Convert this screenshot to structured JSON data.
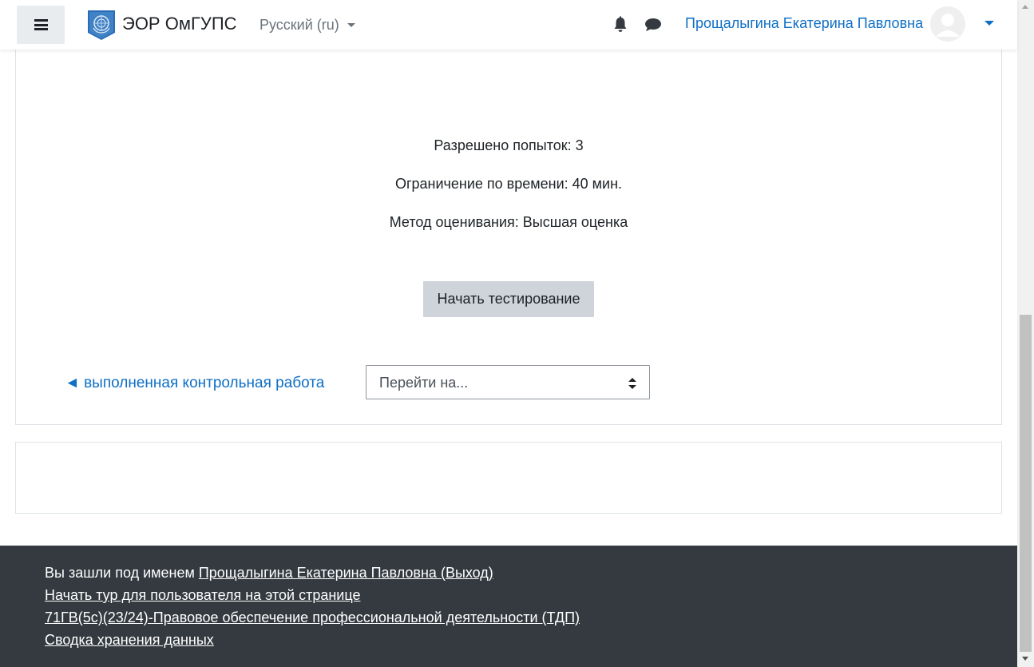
{
  "header": {
    "site_name": "ЭОР ОмГУПС",
    "language": "Русский (ru)",
    "user_name": "Прощалыгина Екатерина Павловна",
    "icons": [
      "menu-icon",
      "bell-icon",
      "chat-icon",
      "avatar-icon",
      "chevron-down-icon"
    ]
  },
  "quiz": {
    "attempts_allowed": "Разрешено попыток: 3",
    "time_limit": "Ограничение по времени: 40 мин.",
    "grading_method": "Метод оценивания: Высшая оценка",
    "start_button": "Начать тестирование"
  },
  "navigation": {
    "prev_activity": "◄ выполненная контрольная работа",
    "jump_to_placeholder": "Перейти на..."
  },
  "footer": {
    "logged_in_prefix": "Вы зашли под именем ",
    "logged_in_user": "Прощалыгина Екатерина Павловна",
    "logout_open": " (",
    "logout_label": "Выход",
    "logout_close": ")",
    "tour_link": "Начать тур для пользователя на этой странице",
    "course_link": "71ГВ(5с)(23/24)-Правовое обеспечение профессиональной деятельности (ТДП)",
    "data_retention_link": "Сводка хранения данных"
  },
  "colors": {
    "link": "#0f6fc5",
    "footer_bg": "#343a40",
    "button_bg": "#ced4da"
  }
}
